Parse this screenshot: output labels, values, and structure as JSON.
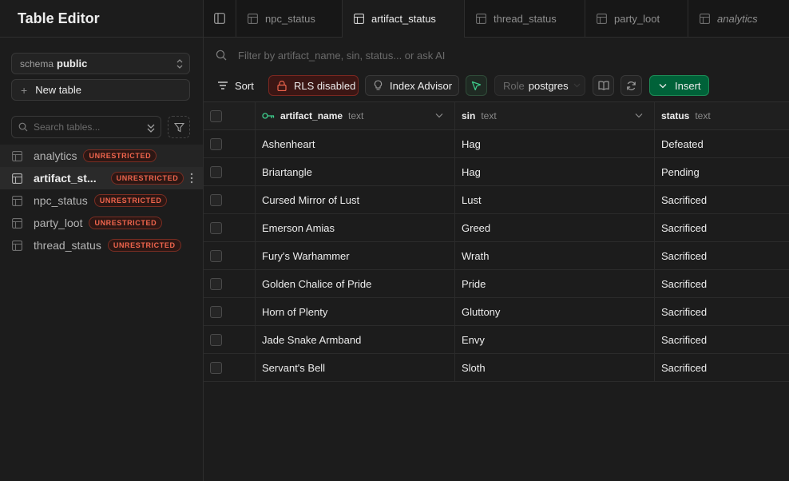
{
  "sidebar": {
    "title": "Table Editor",
    "schema_label": "schema",
    "schema_value": "public",
    "new_table_label": "New table",
    "search_placeholder": "Search tables...",
    "tables": [
      {
        "name": "analytics",
        "badge": "UNRESTRICTED"
      },
      {
        "name": "artifact_st...",
        "badge": "UNRESTRICTED"
      },
      {
        "name": "npc_status",
        "badge": "UNRESTRICTED"
      },
      {
        "name": "party_loot",
        "badge": "UNRESTRICTED"
      },
      {
        "name": "thread_status",
        "badge": "UNRESTRICTED"
      }
    ]
  },
  "tabs": [
    {
      "label": "npc_status"
    },
    {
      "label": "artifact_status"
    },
    {
      "label": "thread_status"
    },
    {
      "label": "party_loot"
    },
    {
      "label": "analytics"
    }
  ],
  "filter": {
    "placeholder": "Filter by artifact_name, sin, status... or ask AI"
  },
  "toolbar": {
    "sort_label": "Sort",
    "rls_label": "RLS disabled",
    "index_label": "Index Advisor",
    "role_key": "Role",
    "role_value": "postgres",
    "insert_label": "Insert"
  },
  "grid": {
    "columns": [
      {
        "name": "artifact_name",
        "type": "text"
      },
      {
        "name": "sin",
        "type": "text"
      },
      {
        "name": "status",
        "type": "text"
      }
    ],
    "rows": [
      [
        "Ashenheart",
        "Hag",
        "Defeated"
      ],
      [
        "Briartangle",
        "Hag",
        "Pending"
      ],
      [
        "Cursed Mirror of Lust",
        "Lust",
        "Sacrificed"
      ],
      [
        "Emerson Amias",
        "Greed",
        "Sacrificed"
      ],
      [
        "Fury's Warhammer",
        "Wrath",
        "Sacrificed"
      ],
      [
        "Golden Chalice of Pride",
        "Pride",
        "Sacrificed"
      ],
      [
        "Horn of Plenty",
        "Gluttony",
        "Sacrificed"
      ],
      [
        "Jade Snake Armband",
        "Envy",
        "Sacrificed"
      ],
      [
        "Servant's Bell",
        "Sloth",
        "Sacrificed"
      ]
    ]
  },
  "colors": {
    "background": "#1c1c1c",
    "accent_green": "#3ecf8e",
    "insert_green": "#006239",
    "danger_red": "#f0654d"
  }
}
